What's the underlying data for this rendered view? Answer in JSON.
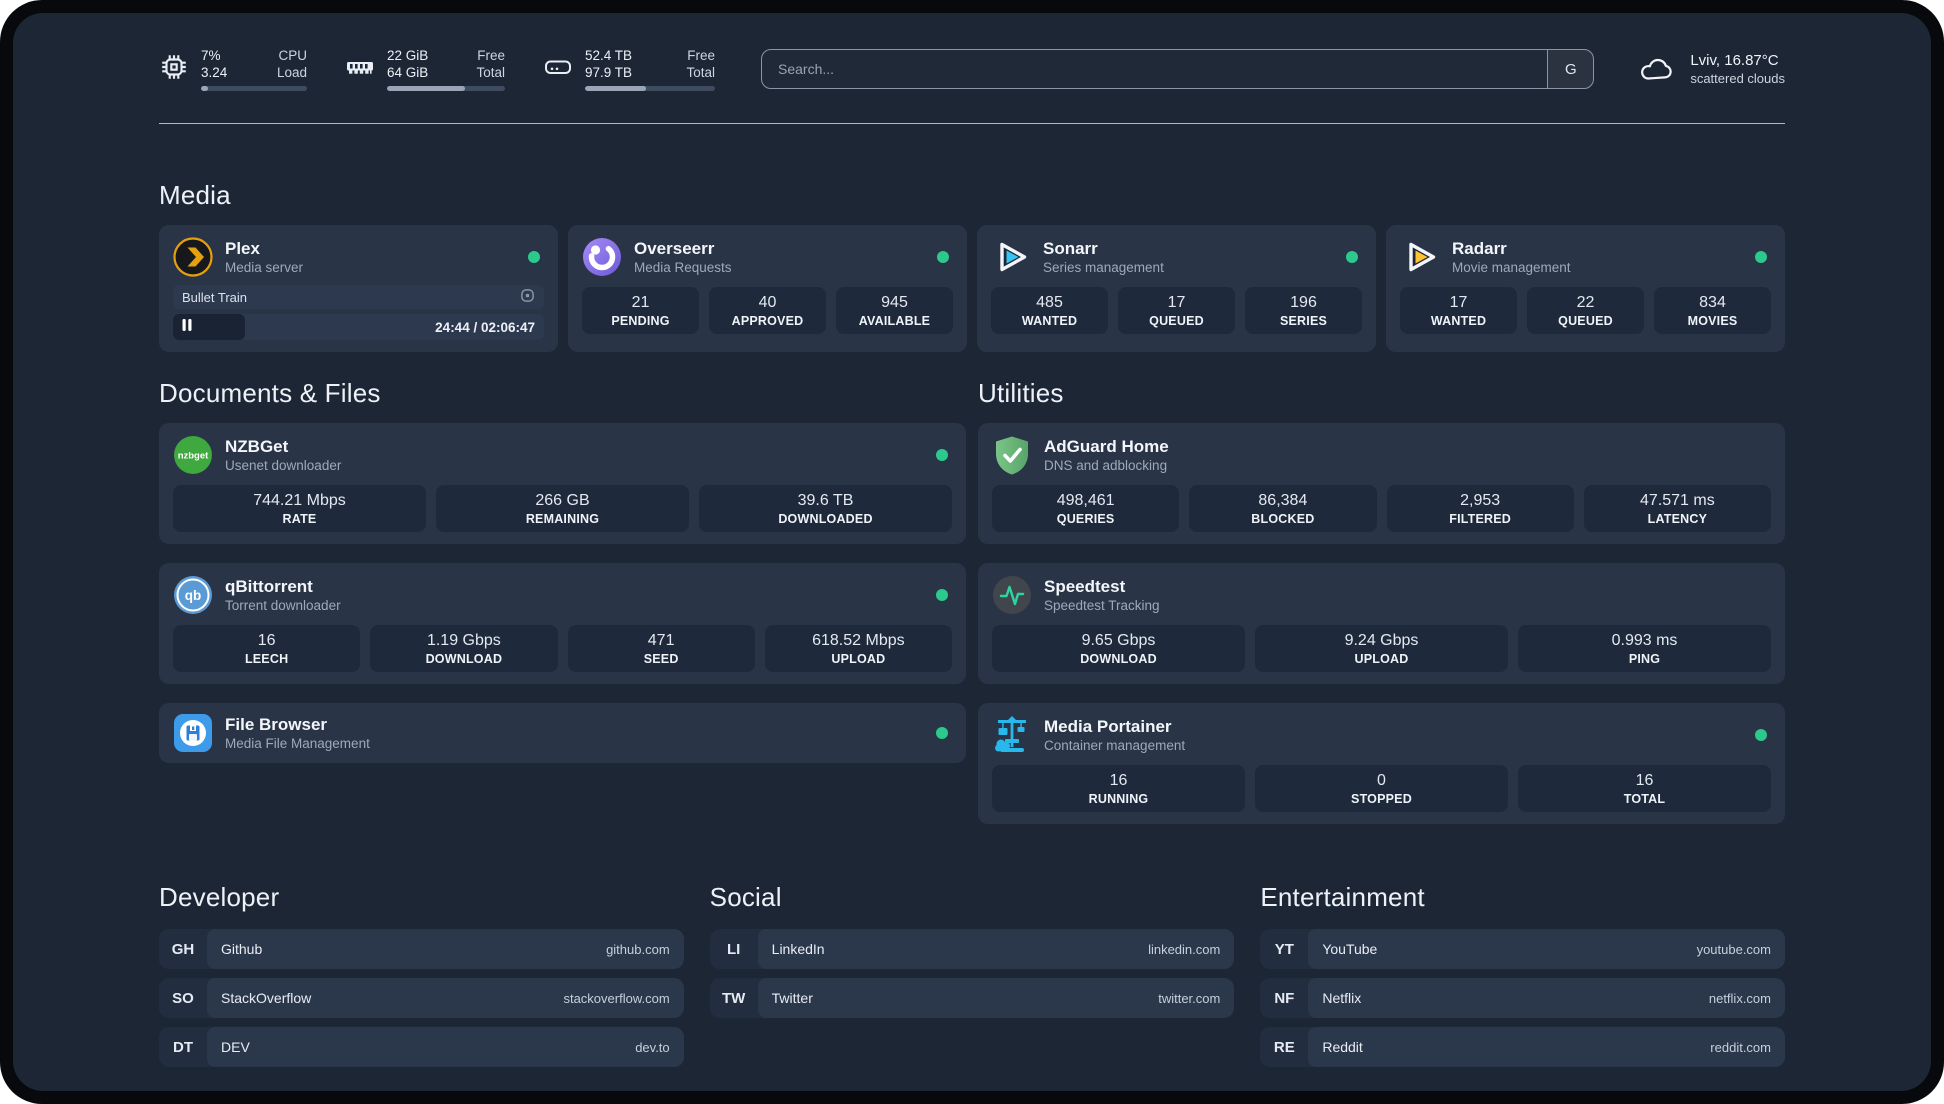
{
  "header": {
    "resources": [
      {
        "value1": "7%",
        "label1": "CPU",
        "value2": "3.24",
        "label2": "Load",
        "progress": 7
      },
      {
        "value1": "22 GiB",
        "label1": "Free",
        "value2": "64 GiB",
        "label2": "Total",
        "progress": 66
      },
      {
        "value1": "52.4 TB",
        "label1": "Free",
        "value2": "97.9 TB",
        "label2": "Total",
        "progress": 47
      }
    ],
    "search": {
      "placeholder": "Search...",
      "provider": "G"
    },
    "weather": {
      "location": "Lviv, 16.87°C",
      "condition": "scattered clouds"
    }
  },
  "media": {
    "heading": "Media",
    "plex": {
      "title": "Plex",
      "subtitle": "Media server",
      "now_playing": "Bullet Train",
      "time": "24:44 / 02:06:47",
      "progress": 19.5
    },
    "overseerr": {
      "title": "Overseerr",
      "subtitle": "Media Requests",
      "stats": [
        {
          "value": "21",
          "label": "PENDING"
        },
        {
          "value": "40",
          "label": "APPROVED"
        },
        {
          "value": "945",
          "label": "AVAILABLE"
        }
      ]
    },
    "sonarr": {
      "title": "Sonarr",
      "subtitle": "Series management",
      "stats": [
        {
          "value": "485",
          "label": "WANTED"
        },
        {
          "value": "17",
          "label": "QUEUED"
        },
        {
          "value": "196",
          "label": "SERIES"
        }
      ]
    },
    "radarr": {
      "title": "Radarr",
      "subtitle": "Movie management",
      "stats": [
        {
          "value": "17",
          "label": "WANTED"
        },
        {
          "value": "22",
          "label": "QUEUED"
        },
        {
          "value": "834",
          "label": "MOVIES"
        }
      ]
    }
  },
  "documents": {
    "heading": "Documents & Files",
    "nzbget": {
      "title": "NZBGet",
      "subtitle": "Usenet downloader",
      "stats": [
        {
          "value": "744.21 Mbps",
          "label": "RATE"
        },
        {
          "value": "266 GB",
          "label": "REMAINING"
        },
        {
          "value": "39.6 TB",
          "label": "DOWNLOADED"
        }
      ]
    },
    "qbittorrent": {
      "title": "qBittorrent",
      "subtitle": "Torrent downloader",
      "stats": [
        {
          "value": "16",
          "label": "LEECH"
        },
        {
          "value": "1.19 Gbps",
          "label": "DOWNLOAD"
        },
        {
          "value": "471",
          "label": "SEED"
        },
        {
          "value": "618.52 Mbps",
          "label": "UPLOAD"
        }
      ]
    },
    "filebrowser": {
      "title": "File Browser",
      "subtitle": "Media File Management"
    }
  },
  "utilities": {
    "heading": "Utilities",
    "adguard": {
      "title": "AdGuard Home",
      "subtitle": "DNS and adblocking",
      "stats": [
        {
          "value": "498,461",
          "label": "QUERIES"
        },
        {
          "value": "86,384",
          "label": "BLOCKED"
        },
        {
          "value": "2,953",
          "label": "FILTERED"
        },
        {
          "value": "47.571 ms",
          "label": "LATENCY"
        }
      ]
    },
    "speedtest": {
      "title": "Speedtest",
      "subtitle": "Speedtest Tracking",
      "stats": [
        {
          "value": "9.65 Gbps",
          "label": "DOWNLOAD"
        },
        {
          "value": "9.24 Gbps",
          "label": "UPLOAD"
        },
        {
          "value": "0.993 ms",
          "label": "PING"
        }
      ]
    },
    "portainer": {
      "title": "Media Portainer",
      "subtitle": "Container management",
      "stats": [
        {
          "value": "16",
          "label": "RUNNING"
        },
        {
          "value": "0",
          "label": "STOPPED"
        },
        {
          "value": "16",
          "label": "TOTAL"
        }
      ]
    }
  },
  "bookmarks": [
    {
      "heading": "Developer",
      "links": [
        {
          "abbr": "GH",
          "name": "Github",
          "domain": "github.com"
        },
        {
          "abbr": "SO",
          "name": "StackOverflow",
          "domain": "stackoverflow.com"
        },
        {
          "abbr": "DT",
          "name": "DEV",
          "domain": "dev.to"
        }
      ]
    },
    {
      "heading": "Social",
      "links": [
        {
          "abbr": "LI",
          "name": "LinkedIn",
          "domain": "linkedin.com"
        },
        {
          "abbr": "TW",
          "name": "Twitter",
          "domain": "twitter.com"
        }
      ]
    },
    {
      "heading": "Entertainment",
      "links": [
        {
          "abbr": "YT",
          "name": "YouTube",
          "domain": "youtube.com"
        },
        {
          "abbr": "NF",
          "name": "Netflix",
          "domain": "netflix.com"
        },
        {
          "abbr": "RE",
          "name": "Reddit",
          "domain": "reddit.com"
        }
      ]
    }
  ],
  "icons": {
    "nzbget_label": "nzbget",
    "qb_label": "qb"
  },
  "colors": {
    "panel_bg": "#1d2634",
    "card_bg": "#2a3447",
    "stat_bg": "#1e293b",
    "status_online": "#2bc98c",
    "plex": "#e5a00d",
    "sonarr": "#35c5f4",
    "radarr": "#ffc230",
    "nzbget": "#3fa83f",
    "qbittorrent": "#5b9bd5",
    "adguard": "#67b17a",
    "speedtest_pulse": "#2dd4a0",
    "portainer": "#29b8eb"
  }
}
